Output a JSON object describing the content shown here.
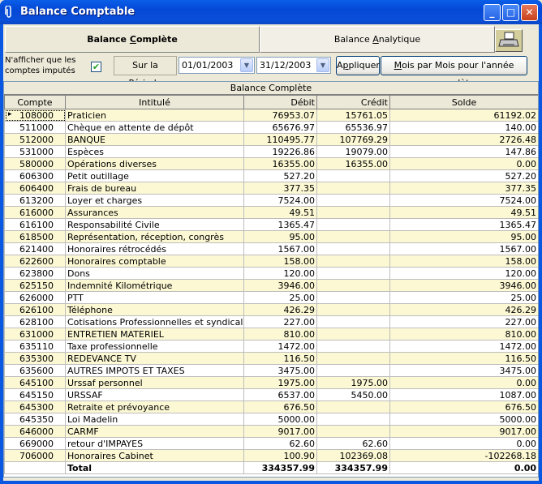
{
  "window": {
    "title": "Balance Comptable"
  },
  "tabs": [
    {
      "label_pre": "Balance ",
      "label_key": "C",
      "label_post": "omplète"
    },
    {
      "label_pre": "Balance ",
      "label_key": "A",
      "label_post": "nalytique"
    }
  ],
  "filters": {
    "only_imputed_label": "N'afficher que les comptes imputés",
    "only_imputed_checked": "✔",
    "periode_pre": "Sur la ",
    "periode_key": "P",
    "periode_post": "ériode",
    "date_from": "01/01/2003",
    "date_to": "31/12/2003",
    "apply_pre": "A",
    "apply_key": "p",
    "apply_post": "pliquer",
    "monthly_key": "M",
    "monthly_post": "ois par Mois pour l'année complète"
  },
  "grid": {
    "caption": "Balance Complète",
    "columns": [
      "Compte",
      "Intitulé",
      "Débit",
      "Crédit",
      "Solde"
    ],
    "rows": [
      [
        "108000",
        "Praticien",
        "76953.07",
        "15761.05",
        "61192.02"
      ],
      [
        "511000",
        "Chèque en attente de dépôt",
        "65676.97",
        "65536.97",
        "140.00"
      ],
      [
        "512000",
        "BANQUE",
        "110495.77",
        "107769.29",
        "2726.48"
      ],
      [
        "531000",
        "Espèces",
        "19226.86",
        "19079.00",
        "147.86"
      ],
      [
        "580000",
        "Opérations diverses",
        "16355.00",
        "16355.00",
        "0.00"
      ],
      [
        "606300",
        "Petit outillage",
        "527.20",
        "",
        "527.20"
      ],
      [
        "606400",
        "Frais de bureau",
        "377.35",
        "",
        "377.35"
      ],
      [
        "613200",
        "Loyer et charges",
        "7524.00",
        "",
        "7524.00"
      ],
      [
        "616000",
        "Assurances",
        "49.51",
        "",
        "49.51"
      ],
      [
        "616100",
        "Responsabilité Civile",
        "1365.47",
        "",
        "1365.47"
      ],
      [
        "618500",
        "Représentation, réception, congrès",
        "95.00",
        "",
        "95.00"
      ],
      [
        "621400",
        "Honoraires rétrocédés",
        "1567.00",
        "",
        "1567.00"
      ],
      [
        "622600",
        "Honoraires comptable",
        "158.00",
        "",
        "158.00"
      ],
      [
        "623800",
        "Dons",
        "120.00",
        "",
        "120.00"
      ],
      [
        "625150",
        "Indemnité Kilométrique",
        "3946.00",
        "",
        "3946.00"
      ],
      [
        "626000",
        "PTT",
        "25.00",
        "",
        "25.00"
      ],
      [
        "626100",
        "Téléphone",
        "426.29",
        "",
        "426.29"
      ],
      [
        "628100",
        "Cotisations Professionnelles et syndicales",
        "227.00",
        "",
        "227.00"
      ],
      [
        "631000",
        "ENTRETIEN MATERIEL",
        "810.00",
        "",
        "810.00"
      ],
      [
        "635110",
        "Taxe professionnelle",
        "1472.00",
        "",
        "1472.00"
      ],
      [
        "635300",
        "REDEVANCE TV",
        "116.50",
        "",
        "116.50"
      ],
      [
        "635600",
        "AUTRES IMPOTS ET TAXES",
        "3475.00",
        "",
        "3475.00"
      ],
      [
        "645100",
        "Urssaf personnel",
        "1975.00",
        "1975.00",
        "0.00"
      ],
      [
        "645150",
        "URSSAF",
        "6537.00",
        "5450.00",
        "1087.00"
      ],
      [
        "645300",
        "Retraite et prévoyance",
        "676.50",
        "",
        "676.50"
      ],
      [
        "645350",
        "Loi Madelin",
        "5000.00",
        "",
        "5000.00"
      ],
      [
        "646000",
        "CARMF",
        "9017.00",
        "",
        "9017.00"
      ],
      [
        "669000",
        "retour d'IMPAYES",
        "62.60",
        "62.60",
        "0.00"
      ],
      [
        "706000",
        "Honoraires Cabinet",
        "100.90",
        "102369.08",
        "-102268.18"
      ]
    ],
    "total": {
      "label": "Total",
      "debit": "334357.99",
      "credit": "334357.99",
      "solde": "0.00"
    },
    "selected_row_marker": "▸"
  }
}
